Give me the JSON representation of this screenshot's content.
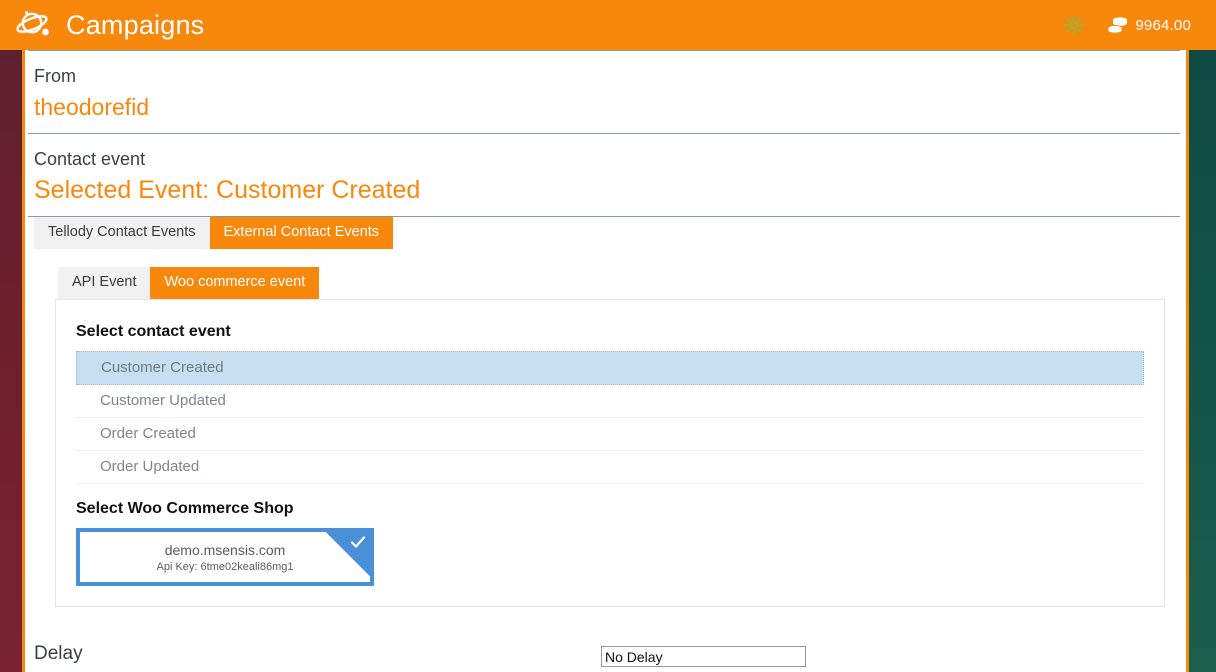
{
  "header": {
    "logo_icon": "planet-icon",
    "title": "Campaigns",
    "theme_icon": "sun-icon",
    "credits_icon": "coins-icon",
    "credits_value": "9964.00",
    "background_color": "#f7880c"
  },
  "theme": {
    "accent": "#f7880c",
    "left_rail_color": "#6e1f2c",
    "right_rail_color": "#135349",
    "selection_blue": "#c7dff1",
    "card_border_blue": "#4a90d9"
  },
  "form": {
    "from": {
      "label": "From",
      "value": "theodorefid"
    },
    "contact_event": {
      "label": "Contact event",
      "value": "Selected Event: Customer Created"
    }
  },
  "tabs_primary": [
    {
      "label": "Tellody Contact Events",
      "active": false
    },
    {
      "label": "External Contact Events",
      "active": true
    }
  ],
  "tabs_secondary": [
    {
      "label": "API Event",
      "active": false
    },
    {
      "label": "Woo commerce event",
      "active": true
    }
  ],
  "panel": {
    "contact_event_heading": "Select contact event",
    "events": [
      {
        "label": "Customer Created",
        "selected": true
      },
      {
        "label": "Customer Updated",
        "selected": false
      },
      {
        "label": "Order Created",
        "selected": false
      },
      {
        "label": "Order Updated",
        "selected": false
      }
    ],
    "shop_heading": "Select Woo Commerce Shop",
    "shops": [
      {
        "domain": "demo.msensis.com",
        "api_key_label": "Api Key: 6tme02keali86mg1",
        "selected": true,
        "check_icon": "check-icon"
      }
    ]
  },
  "delay": {
    "label": "Delay",
    "value": "No Delay",
    "placeholder": "No Delay"
  }
}
